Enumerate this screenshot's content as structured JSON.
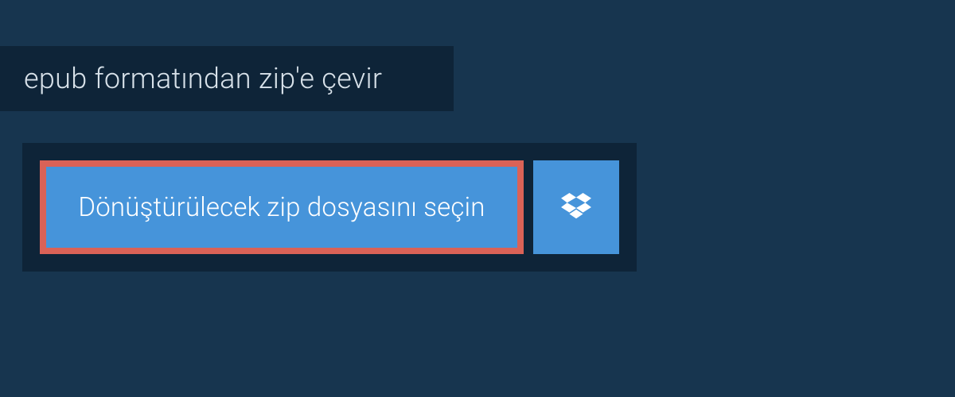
{
  "header": {
    "title": "epub formatından zip'e çevir"
  },
  "upload": {
    "select_file_label": "Dönüştürülecek zip dosyasını seçin"
  },
  "colors": {
    "page_bg": "#17354f",
    "panel_bg": "#0e2438",
    "button_bg": "#4694da",
    "highlight_border": "#da6257",
    "text_light": "#d7e1e9",
    "text_white": "#ffffff"
  }
}
